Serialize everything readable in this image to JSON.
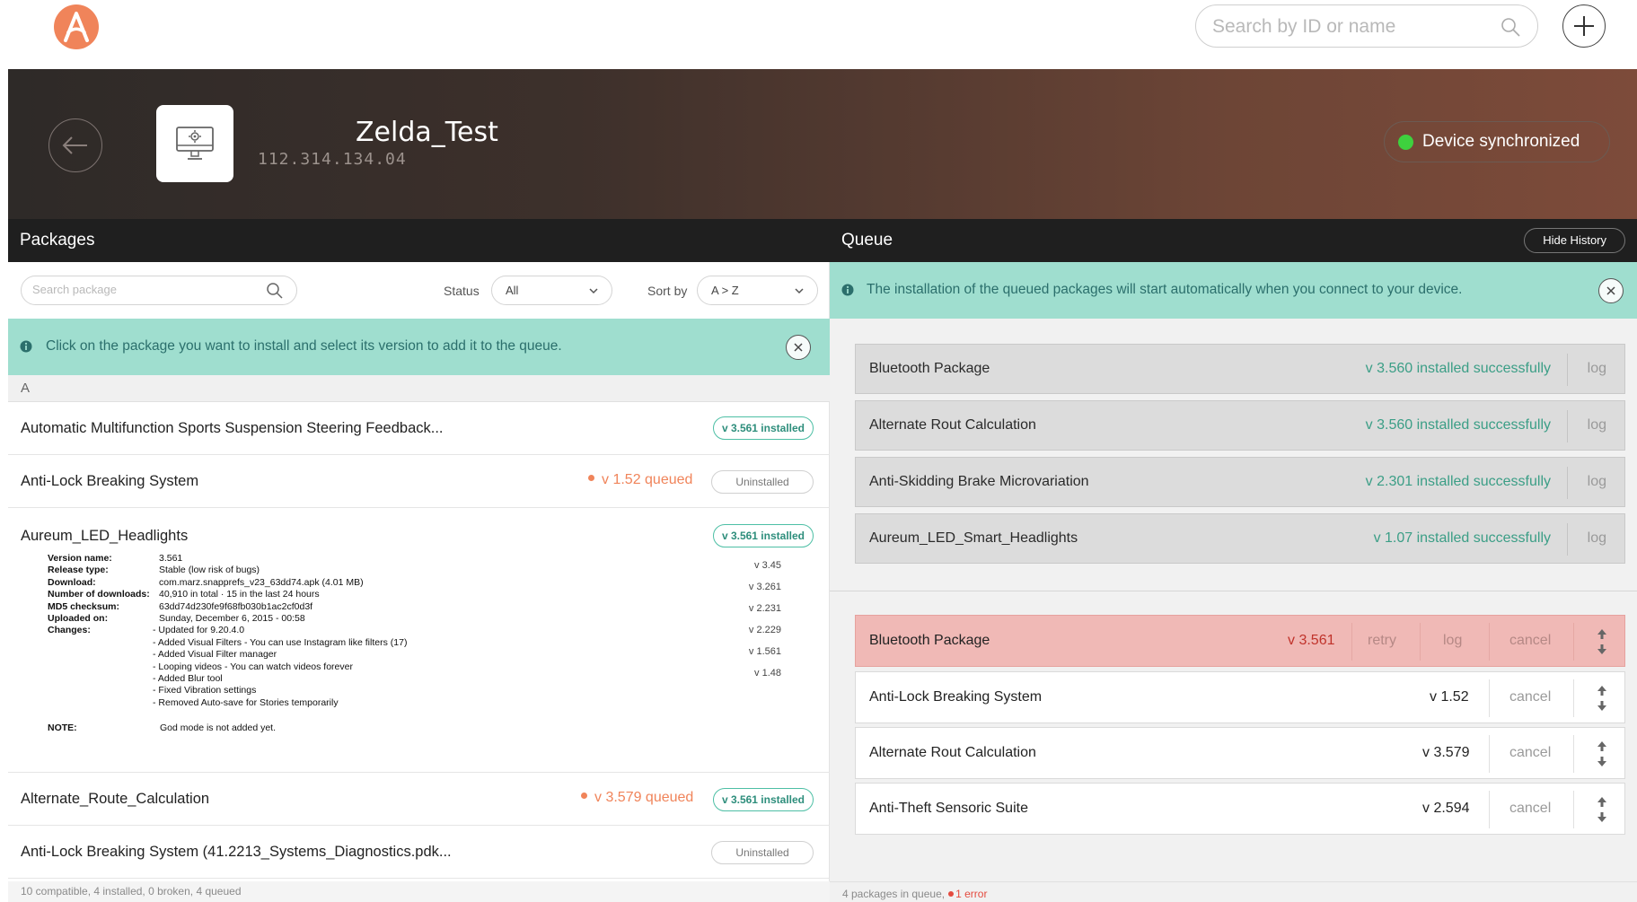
{
  "brand": {
    "logo_letter": "A",
    "accent": "#f0845a"
  },
  "topbar": {
    "search_placeholder": "Search by ID or name",
    "add_icon": "plus-icon"
  },
  "device": {
    "name": "Zelda_Test",
    "ip": "112.314.134.04",
    "sync_status": "Device synchronized",
    "sync_color": "#3ed13e"
  },
  "packages": {
    "title": "Packages",
    "search_placeholder": "Search package",
    "status_label": "Status",
    "status_value": "All",
    "sort_label": "Sort by",
    "sort_value": "A > Z",
    "info": "Click on the package you want to install and select its version to add it to the queue.",
    "group_letter": "A",
    "rows": [
      {
        "name": "Automatic Multifunction Sports Suspension Steering Feedback...",
        "badge": "v 3.561 installed"
      },
      {
        "name": "Anti-Lock Breaking System",
        "queued": "v 1.52 queued",
        "badge": "Uninstalled"
      },
      {
        "name": "Aureum_LED_Headlights",
        "badge": "v 3.561 installed"
      },
      {
        "name": "Alternate_Route_Calculation",
        "queued": "v 3.579 queued",
        "badge": "v 3.561 installed"
      },
      {
        "name": "Anti-Lock Breaking System (41.2213_Systems_Diagnostics.pdk...",
        "badge": "Uninstalled"
      }
    ],
    "details": {
      "version_name_label": "Version name:",
      "version_name": "3.561",
      "release_type_label": "Release type:",
      "release_type": "Stable (low risk of bugs)",
      "download_label": "Download:",
      "download": "com.marz.snapprefs_v23_63dd74.apk (4.01 MB)",
      "downloads_label": "Number of downloads:",
      "downloads": "40,910 in total · 15 in the last 24 hours",
      "md5_label": "MD5 checksum:",
      "md5": "63dd74d230fe9f68fb030b1ac2cf0d3f",
      "uploaded_label": "Uploaded on:",
      "uploaded": "Sunday, December 6, 2015 - 00:58",
      "changes_label": "Changes:",
      "changes": [
        "- Updated for 9.20.4.0",
        "- Added Visual Filters - You can use Instagram like filters (17)",
        "- Added Visual Filter manager",
        "- Looping videos - You can watch videos forever",
        "- Added Blur tool",
        "- Fixed Vibration settings",
        "- Removed Auto-save for Stories temporarily"
      ],
      "note_label": "NOTE:",
      "note": "God mode is not added yet.",
      "versions": [
        "v 3.45",
        "v 3.261",
        "v 2.231",
        "v 2.229",
        "v 1.561",
        "v 1.48"
      ]
    },
    "footer": "10 compatible, 4 installed, 0 broken, 4 queued"
  },
  "queue": {
    "title": "Queue",
    "hide_history": "Hide History",
    "info": "The installation of the queued packages will start automatically when you connect to your device.",
    "history": [
      {
        "name": "Bluetooth Package",
        "status": "v 3.560 installed successfully",
        "log": "log"
      },
      {
        "name": "Alternate Rout Calculation",
        "status": "v 3.560 installed successfully",
        "log": "log"
      },
      {
        "name": "Anti-Skidding Brake Microvariation",
        "status": "v 2.301 installed successfully",
        "log": "log"
      },
      {
        "name": "Aureum_LED_Smart_Headlights",
        "status": "v 1.07 installed successfully",
        "log": "log"
      }
    ],
    "items": [
      {
        "name": "Bluetooth Package",
        "version": "v 3.561",
        "retry": "retry",
        "log": "log",
        "cancel": "cancel",
        "error": true
      },
      {
        "name": "Anti-Lock Breaking System",
        "version": "v 1.52",
        "cancel": "cancel"
      },
      {
        "name": "Alternate Rout Calculation",
        "version": "v 3.579",
        "cancel": "cancel"
      },
      {
        "name": "Anti-Theft Sensoric Suite",
        "version": "v 2.594",
        "cancel": "cancel"
      }
    ],
    "footer_count": "4 packages in queue,",
    "footer_error": "1 error"
  }
}
